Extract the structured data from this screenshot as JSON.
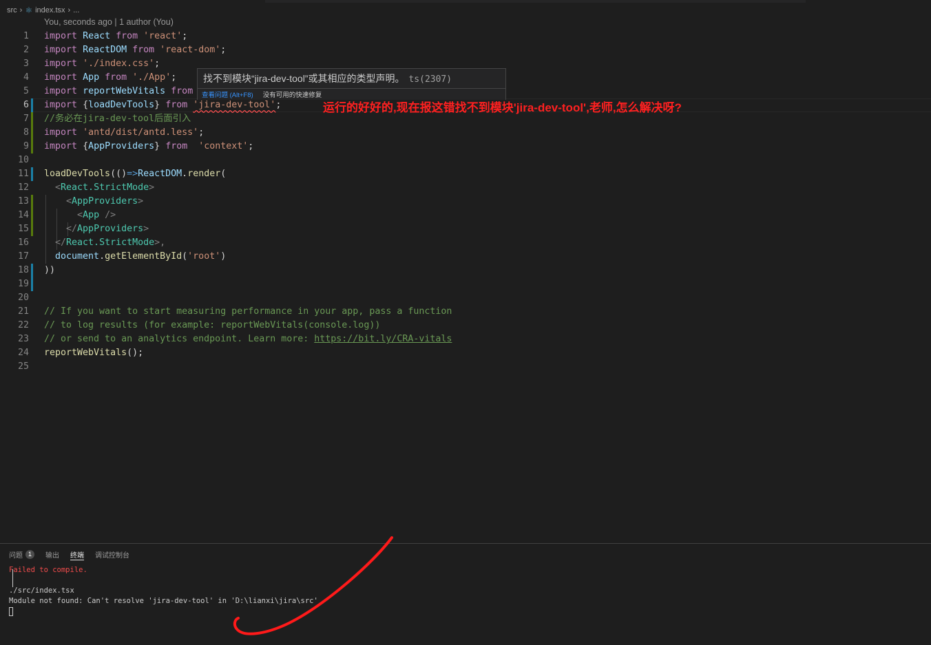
{
  "breadcrumb": {
    "folder": "src",
    "file": "index.tsx",
    "more": "..."
  },
  "codelens": "You, seconds ago | 1 author (You)",
  "lines": [
    {
      "n": "1"
    },
    {
      "n": "2"
    },
    {
      "n": "3"
    },
    {
      "n": "4"
    },
    {
      "n": "5"
    },
    {
      "n": "6"
    },
    {
      "n": "7"
    },
    {
      "n": "8"
    },
    {
      "n": "9"
    },
    {
      "n": "10"
    },
    {
      "n": "11"
    },
    {
      "n": "12"
    },
    {
      "n": "13"
    },
    {
      "n": "14"
    },
    {
      "n": "15"
    },
    {
      "n": "16"
    },
    {
      "n": "17"
    },
    {
      "n": "18"
    },
    {
      "n": "19"
    },
    {
      "n": "20"
    },
    {
      "n": "21"
    },
    {
      "n": "22"
    },
    {
      "n": "23"
    },
    {
      "n": "24"
    },
    {
      "n": "25"
    }
  ],
  "code": {
    "l1": [
      "import",
      "React",
      "from",
      "'react'",
      ";"
    ],
    "l2": [
      "import",
      "ReactDOM",
      "from",
      "'react-dom'",
      ";"
    ],
    "l3": [
      "import",
      "'./index.css'",
      ";"
    ],
    "l4": [
      "import",
      "App",
      "from",
      "'./App'",
      ";"
    ],
    "l5": [
      "import",
      "reportWebVitals",
      "from"
    ],
    "l6": [
      "import",
      "{",
      "loadDevTools",
      "}",
      "from",
      "'jira-dev-tool'",
      ";"
    ],
    "l7": "//务必在jira-dev-tool后面引入",
    "l8": [
      "import",
      "'antd/dist/antd.less'",
      ";"
    ],
    "l9": [
      "import",
      "{",
      "AppProviders",
      "}",
      "from",
      "'context'",
      ";"
    ],
    "l11": [
      "loadDevTools",
      "(()",
      "=>",
      "ReactDOM",
      ".",
      "render",
      "("
    ],
    "l12": [
      "<",
      "React.StrictMode",
      ">"
    ],
    "l13": [
      "<",
      "AppProviders",
      ">"
    ],
    "l14": [
      "<",
      "App",
      " />"
    ],
    "l15": [
      "</",
      "AppProviders",
      ">"
    ],
    "l16": [
      "</",
      "React.StrictMode",
      ">,"
    ],
    "l17": [
      "document",
      ".",
      "getElementById",
      "(",
      "'root'",
      ")"
    ],
    "l18": "))",
    "l21": "// If you want to start measuring performance in your app, pass a function",
    "l22": "// to log results (for example: reportWebVitals(console.log))",
    "l23a": "// or send to an analytics endpoint. Learn more: ",
    "l23b": "https://bit.ly/CRA-vitals",
    "l24": [
      "reportWebVitals",
      "();"
    ]
  },
  "hover": {
    "message": "找不到模块“jira-dev-tool”或其相应的类型声明。",
    "code": "ts(2307)",
    "action_view": "查看问题 (Alt+F8)",
    "action_fix": "没有可用的快速修复"
  },
  "annotation": "运行的好好的,现在报这错找不到模块'jira-dev-tool',老师,怎么解决呀?",
  "panel": {
    "tabs": [
      {
        "label": "问题",
        "badge": "1"
      },
      {
        "label": "输出"
      },
      {
        "label": "终端"
      },
      {
        "label": "调试控制台"
      }
    ],
    "terminal": {
      "error": "Failed to compile.",
      "file": "./src/index.tsx",
      "message": "Module not found: Can't resolve 'jira-dev-tool' in 'D:\\lianxi\\jira\\src'"
    }
  },
  "colors": {
    "editor_bg": "#1e1e1e",
    "annotation": "#ff2020",
    "error": "#f14c4c",
    "link": "#3794ff"
  }
}
